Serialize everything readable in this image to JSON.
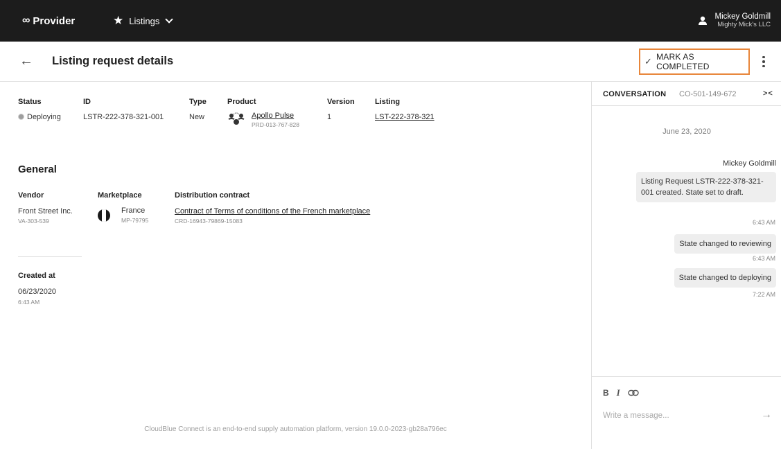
{
  "topbar": {
    "brand": "Provider",
    "brand_logo": "∞",
    "nav_label": "Listings",
    "user_name": "Mickey Goldmill",
    "user_org": "Mighty Mick's LLC"
  },
  "header": {
    "title": "Listing request details",
    "mark_completed_label": "MARK AS COMPLETED"
  },
  "details": {
    "status": {
      "label": "Status",
      "value": "Deploying"
    },
    "id": {
      "label": "ID",
      "value": "LSTR-222-378-321-001"
    },
    "type": {
      "label": "Type",
      "value": "New"
    },
    "product": {
      "label": "Product",
      "name": "Apollo Pulse",
      "id": "PRD-013-767-828"
    },
    "version": {
      "label": "Version",
      "value": "1"
    },
    "listing": {
      "label": "Listing",
      "value": "LST-222-378-321"
    }
  },
  "general": {
    "title": "General",
    "vendor": {
      "label": "Vendor",
      "name": "Front Street Inc.",
      "id": "VA-303-539"
    },
    "marketplace": {
      "label": "Marketplace",
      "name": "France",
      "id": "MP-79795"
    },
    "contract": {
      "label": "Distribution contract",
      "name": "Contract of Terms of conditions of the French marketplace",
      "id": "CRD-16943-79869-15083"
    }
  },
  "created": {
    "label": "Created at",
    "date": "06/23/2020",
    "time": "6:43 AM"
  },
  "footer": "CloudBlue Connect is an end-to-end supply automation platform, version 19.0.0-2023-gb28a796ec",
  "conversation": {
    "title": "CONVERSATION",
    "id": "CO-501-149-672",
    "collapse_label": "><",
    "date": "June 23, 2020",
    "author": "Mickey Goldmill",
    "messages": [
      {
        "text": "Listing Request LSTR-222-378-321-001 created. State set to draft.",
        "time": "6:43 AM"
      },
      {
        "text": "State changed to reviewing",
        "time": "6:43 AM"
      },
      {
        "text": "State changed to deploying",
        "time": "7:22 AM"
      }
    ],
    "input_placeholder": "Write a message...",
    "format_bold": "B",
    "format_italic": "I"
  },
  "colors": {
    "topbar_bg": "#1c1c1c",
    "highlight_border": "#e8863a",
    "bubble_bg": "#eeeeee"
  }
}
